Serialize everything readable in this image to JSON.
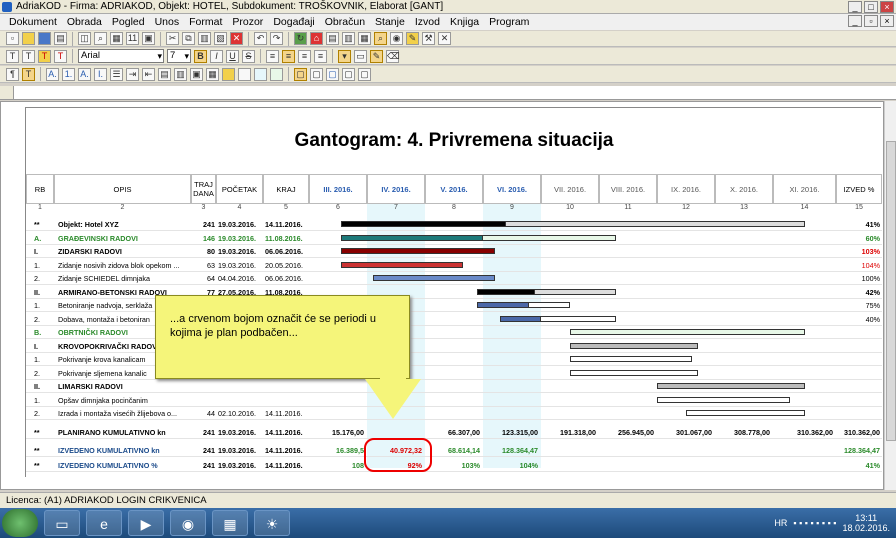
{
  "window": {
    "title": "AdriaKOD - Firma: ADRIAKOD,  Objekt: HOTEL,  Subdokument: TROŠKOVNIK, Elaborat [GANT]"
  },
  "menu": [
    "Dokument",
    "Obrada",
    "Pogled",
    "Unos",
    "Format",
    "Prozor",
    "Događaji",
    "Obračun",
    "Stanje",
    "Izvod",
    "Knjiga",
    "Program"
  ],
  "font": {
    "name": "Arial",
    "size": "7"
  },
  "report": {
    "title": "Gantogram: 4. Privremena situacija"
  },
  "columns": [
    {
      "label": "RB",
      "num": "1"
    },
    {
      "label": "OPIS",
      "num": "2"
    },
    {
      "label": "TRAJ DANA",
      "num": "3"
    },
    {
      "label": "POČETAK",
      "num": "4"
    },
    {
      "label": "KRAJ",
      "num": "5"
    },
    {
      "label": "III. 2016.",
      "num": "6"
    },
    {
      "label": "IV. 2016.",
      "num": "7"
    },
    {
      "label": "V. 2016.",
      "num": "8"
    },
    {
      "label": "VI. 2016.",
      "num": "9"
    },
    {
      "label": "VII. 2016.",
      "num": "10"
    },
    {
      "label": "VIII. 2016.",
      "num": "11"
    },
    {
      "label": "IX. 2016.",
      "num": "12"
    },
    {
      "label": "X. 2016.",
      "num": "13"
    },
    {
      "label": "XI. 2016.",
      "num": "14"
    },
    {
      "label": "IZVED %",
      "num": "15"
    }
  ],
  "rows": [
    {
      "rb": "**",
      "opis": "Objekt: Hotel XYZ",
      "traj": "241",
      "poc": "19.03.2016.",
      "kraj": "14.11.2016.",
      "izved": "41%",
      "style": "bold",
      "barStart": 0.55,
      "barEnd": 8.55,
      "barColor": "#ddd",
      "progEnd": 3.4,
      "progColor": "#000"
    },
    {
      "rb": "A.",
      "opis": "GRAĐEVINSKI RADOVI",
      "traj": "146",
      "poc": "19.03.2016.",
      "kraj": "11.08.2016.",
      "izved": "60%",
      "style": "green",
      "barStart": 0.55,
      "barEnd": 5.3,
      "barColor": "#e8f8e8",
      "progEnd": 3.0,
      "progColor": "#1e7a7a"
    },
    {
      "rb": "I.",
      "opis": "ZIDARSKI RADOVI",
      "traj": "80",
      "poc": "19.03.2016.",
      "kraj": "06.06.2016.",
      "izved": "103%",
      "style": "bold",
      "izvedRed": true,
      "barStart": 0.55,
      "barEnd": 3.2,
      "barColor": "#800",
      "progEnd": 3.2,
      "progColor": "#800"
    },
    {
      "rb": "1.",
      "opis": "Zidanje nosivih zidova blok opekom ...",
      "traj": "63",
      "poc": "19.03.2016.",
      "kraj": "20.05.2016.",
      "izved": "104%",
      "izvedRed": true,
      "barStart": 0.55,
      "barEnd": 2.65,
      "barColor": "#fff",
      "progEnd": 2.65,
      "progColor": "#c33"
    },
    {
      "rb": "2.",
      "opis": "Zidanje SCHIEDEL dimnjaka",
      "traj": "64",
      "poc": "04.04.2016.",
      "kraj": "06.06.2016.",
      "izved": "100%",
      "barStart": 1.1,
      "barEnd": 3.2,
      "barColor": "#6a8ac8",
      "progEnd": 3.2,
      "progColor": "#6a8ac8"
    },
    {
      "rb": "II.",
      "opis": "ARMIRANO-BETONSKI RADOVI",
      "traj": "77",
      "poc": "27.05.2016.",
      "kraj": "11.08.2016.",
      "izved": "42%",
      "style": "bold",
      "barStart": 2.9,
      "barEnd": 5.3,
      "barColor": "#ddd",
      "progEnd": 3.9,
      "progColor": "#000"
    },
    {
      "rb": "1.",
      "opis": "Betoniranje nadvoja, serklaža",
      "traj": "",
      "poc": "",
      "kraj": "",
      "izved": "75%",
      "barStart": 2.9,
      "barEnd": 4.5,
      "barColor": "#fff",
      "progEnd": 3.8,
      "progColor": "#4a68a8"
    },
    {
      "rb": "2.",
      "opis": "Dobava, montaža i betoniran",
      "traj": "",
      "poc": "",
      "kraj": "",
      "izved": "40%",
      "barStart": 3.3,
      "barEnd": 5.3,
      "barColor": "#fff",
      "progEnd": 4.0,
      "progColor": "#4a68a8"
    },
    {
      "rb": "B.",
      "opis": "OBRTNIČKI RADOVI",
      "traj": "",
      "poc": "",
      "kraj": "",
      "izved": "",
      "style": "green",
      "barStart": 4.5,
      "barEnd": 8.55,
      "barColor": "#e8f8e8",
      "progEnd": 4.5,
      "progColor": "#000"
    },
    {
      "rb": "I.",
      "opis": "KROVOPOKRIVAČKI RADOV",
      "traj": "",
      "poc": "",
      "kraj": "",
      "izved": "",
      "style": "bold",
      "barStart": 4.5,
      "barEnd": 6.7,
      "barColor": "#bbb",
      "progEnd": 4.5,
      "progColor": "#000"
    },
    {
      "rb": "1.",
      "opis": "Pokrivanje krova kanalicam",
      "traj": "",
      "poc": "",
      "kraj": "",
      "izved": "",
      "barStart": 4.5,
      "barEnd": 6.6,
      "barColor": "#fff",
      "progEnd": 4.5,
      "progColor": "#000"
    },
    {
      "rb": "2.",
      "opis": "Pokrivanje sljemena kanalic",
      "traj": "",
      "poc": "",
      "kraj": "",
      "izved": "",
      "barStart": 4.5,
      "barEnd": 6.7,
      "barColor": "#fff",
      "progEnd": 4.5,
      "progColor": "#000"
    },
    {
      "rb": "II.",
      "opis": "LIMARSKI RADOVI",
      "traj": "",
      "poc": "",
      "kraj": "",
      "izved": "",
      "style": "bold",
      "barStart": 6.0,
      "barEnd": 8.55,
      "barColor": "#bbb",
      "progEnd": 6.0,
      "progColor": "#000"
    },
    {
      "rb": "1.",
      "opis": "Opšav  dimnjaka pocinčanim",
      "traj": "",
      "poc": "",
      "kraj": "",
      "izved": "",
      "barStart": 6.0,
      "barEnd": 8.3,
      "barColor": "#fff",
      "progEnd": 6.0,
      "progColor": "#000"
    },
    {
      "rb": "2.",
      "opis": "Izrada i montaža visećih žlijebova o...",
      "traj": "44",
      "poc": "02.10.2016.",
      "kraj": "14.11.2016.",
      "izved": "",
      "barStart": 6.5,
      "barEnd": 8.55,
      "barColor": "#fff",
      "progEnd": 6.5,
      "progColor": "#000"
    }
  ],
  "summary": [
    {
      "rb": "**",
      "opis": "PLANIRANO KUMULATIVNO kn",
      "traj": "241",
      "poc": "19.03.2016.",
      "kraj": "14.11.2016.",
      "vals": [
        "15.176,00",
        "",
        "66.307,00",
        "123.315,00",
        "191.318,00",
        "256.945,00",
        "301.067,00",
        "308.778,00",
        "310.362,00"
      ],
      "izved": "310.362,00",
      "color": "#000"
    },
    {
      "rb": "**",
      "opis": "IZVEDENO KUMULATIVNO kn",
      "traj": "241",
      "poc": "19.03.2016.",
      "kraj": "14.11.2016.",
      "vals": [
        "16.389,5",
        "40.972,32",
        "68.614,14",
        "128.364,47",
        "",
        "",
        "",
        "",
        ""
      ],
      "izved": "128.364,47",
      "color": "#2a8a2a"
    },
    {
      "rb": "**",
      "opis": "IZVEDENO KUMULATIVNO %",
      "traj": "241",
      "poc": "19.03.2016.",
      "kraj": "14.11.2016.",
      "vals": [
        "108",
        "92%",
        "103%",
        "104%",
        "",
        "",
        "",
        "",
        ""
      ],
      "izved": "41%",
      "color": "#2a8a2a"
    }
  ],
  "callout": {
    "text": "...a crvenom bojom označit će se periodi u kojima je plan podbačen..."
  },
  "status": {
    "text": "Licenca: (A1) ADRIAKOD LOGIN CRIKVENICA"
  },
  "tray": {
    "lang": "HR",
    "time": "13:11",
    "date": "18.02.2016."
  }
}
